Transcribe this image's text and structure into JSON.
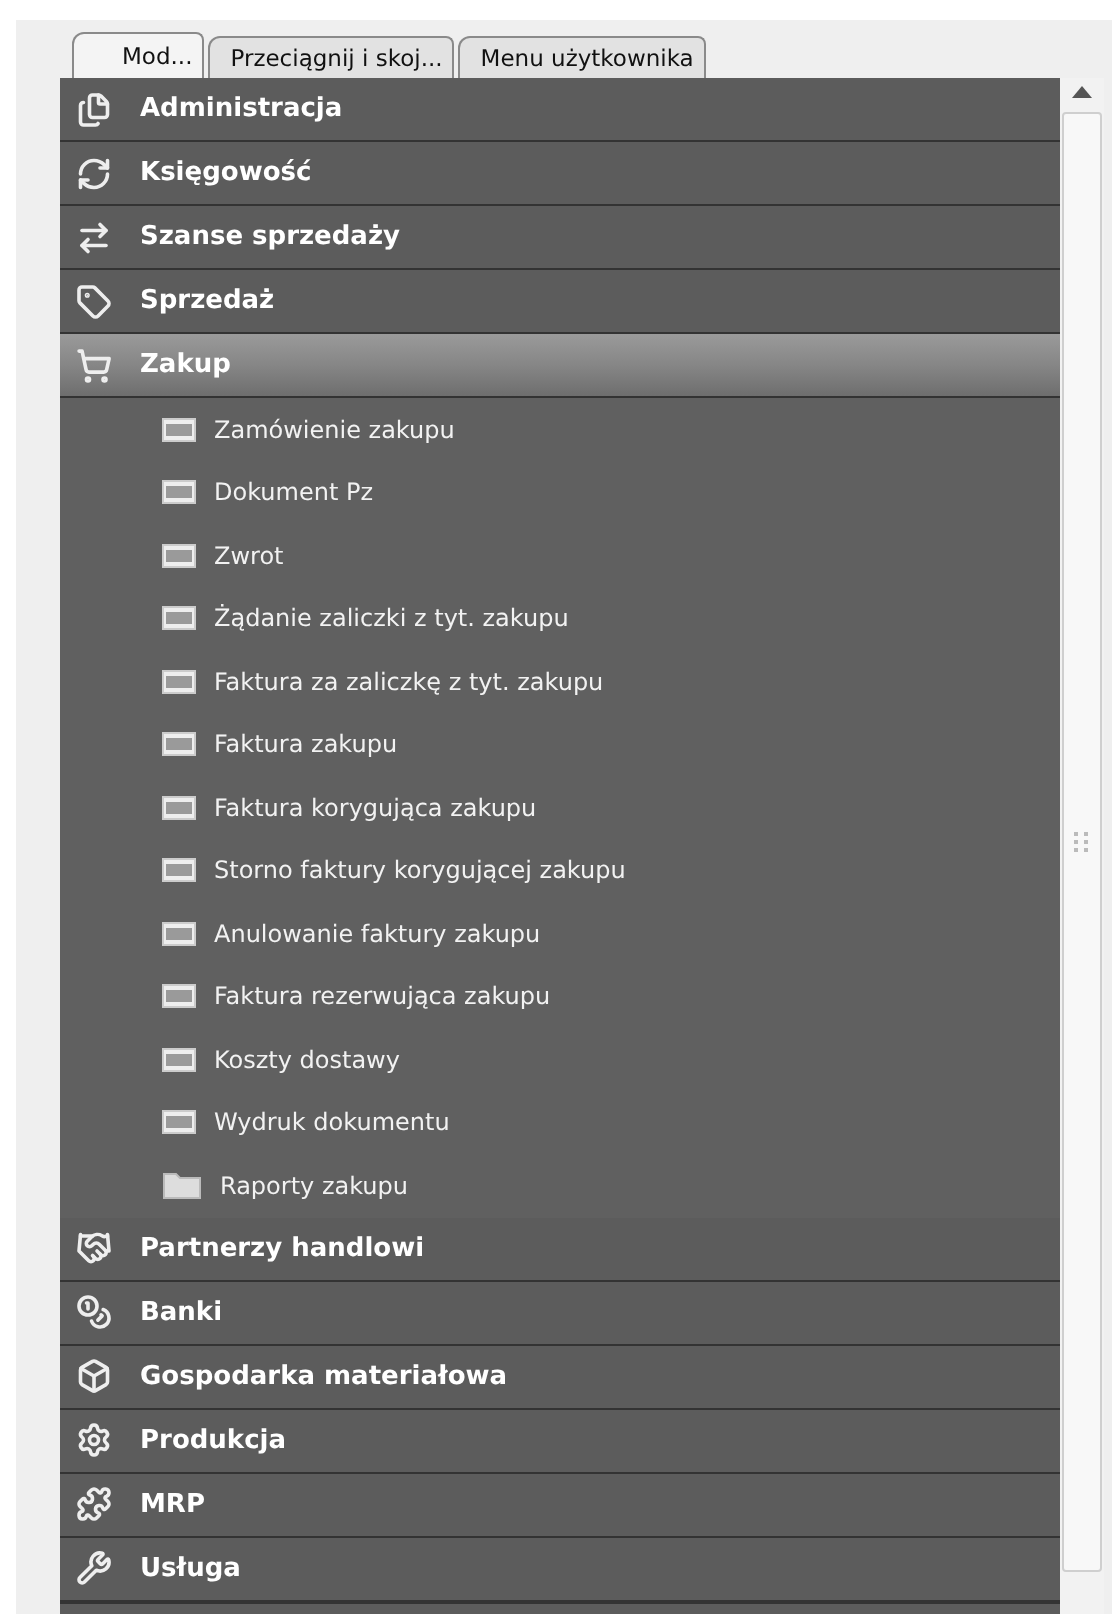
{
  "tabs": [
    {
      "label": "Mod...",
      "selected": true
    },
    {
      "label": "Przeciągnij i skoj...",
      "selected": false
    },
    {
      "label": "Menu użytkownika",
      "selected": false
    }
  ],
  "modules": [
    {
      "label": "Administracja",
      "selected": false
    },
    {
      "label": "Księgowość",
      "selected": false
    },
    {
      "label": "Szanse sprzedaży",
      "selected": false
    },
    {
      "label": "Sprzedaż",
      "selected": false
    },
    {
      "label": "Zakup",
      "selected": true,
      "children": [
        {
          "label": "Zamówienie zakupu",
          "kind": "document"
        },
        {
          "label": "Dokument Pz",
          "kind": "document"
        },
        {
          "label": "Zwrot",
          "kind": "document"
        },
        {
          "label": "Żądanie zaliczki z tyt. zakupu",
          "kind": "document"
        },
        {
          "label": "Faktura za zaliczkę z tyt. zakupu",
          "kind": "document"
        },
        {
          "label": "Faktura zakupu",
          "kind": "document"
        },
        {
          "label": "Faktura korygująca zakupu",
          "kind": "document"
        },
        {
          "label": "Storno faktury korygującej zakupu",
          "kind": "document"
        },
        {
          "label": "Anulowanie faktury zakupu",
          "kind": "document"
        },
        {
          "label": "Faktura rezerwująca zakupu",
          "kind": "document"
        },
        {
          "label": "Koszty dostawy",
          "kind": "document"
        },
        {
          "label": "Wydruk dokumentu",
          "kind": "document"
        },
        {
          "label": "Raporty zakupu",
          "kind": "folder"
        }
      ]
    },
    {
      "label": "Partnerzy handlowi",
      "selected": false
    },
    {
      "label": "Banki",
      "selected": false
    },
    {
      "label": "Gospodarka materiałowa",
      "selected": false
    },
    {
      "label": "Produkcja",
      "selected": false
    },
    {
      "label": "MRP",
      "selected": false
    },
    {
      "label": "Usługa",
      "selected": false
    }
  ]
}
